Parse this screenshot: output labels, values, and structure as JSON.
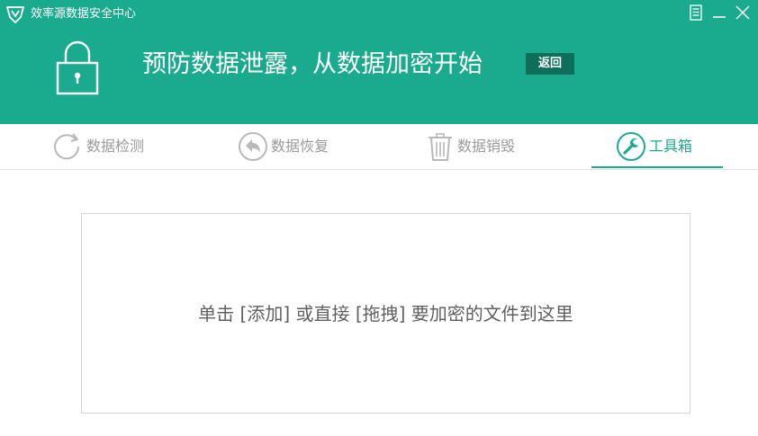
{
  "window": {
    "title": "效率源数据安全中心",
    "menu_icon": "menu-icon",
    "minimize_icon": "minimize-icon",
    "close_icon": "close-icon"
  },
  "banner": {
    "icon": "lock-icon",
    "headline": "预防数据泄露，从数据加密开始",
    "back_label": "返回"
  },
  "tabs": [
    {
      "label": "数据检测",
      "icon": "refresh-icon",
      "active": false
    },
    {
      "label": "数据恢复",
      "icon": "undo-icon",
      "active": false
    },
    {
      "label": "数据销毁",
      "icon": "trash-icon",
      "active": false
    },
    {
      "label": "工具箱",
      "icon": "wrench-icon",
      "active": true
    }
  ],
  "dropzone": {
    "text": "单击 [添加] 或直接 [拖拽] 要加密的文件到这里"
  },
  "colors": {
    "brand": "#1aab8f",
    "brand_dark": "#0f6e5a",
    "inactive_text": "#9a9a9a"
  }
}
